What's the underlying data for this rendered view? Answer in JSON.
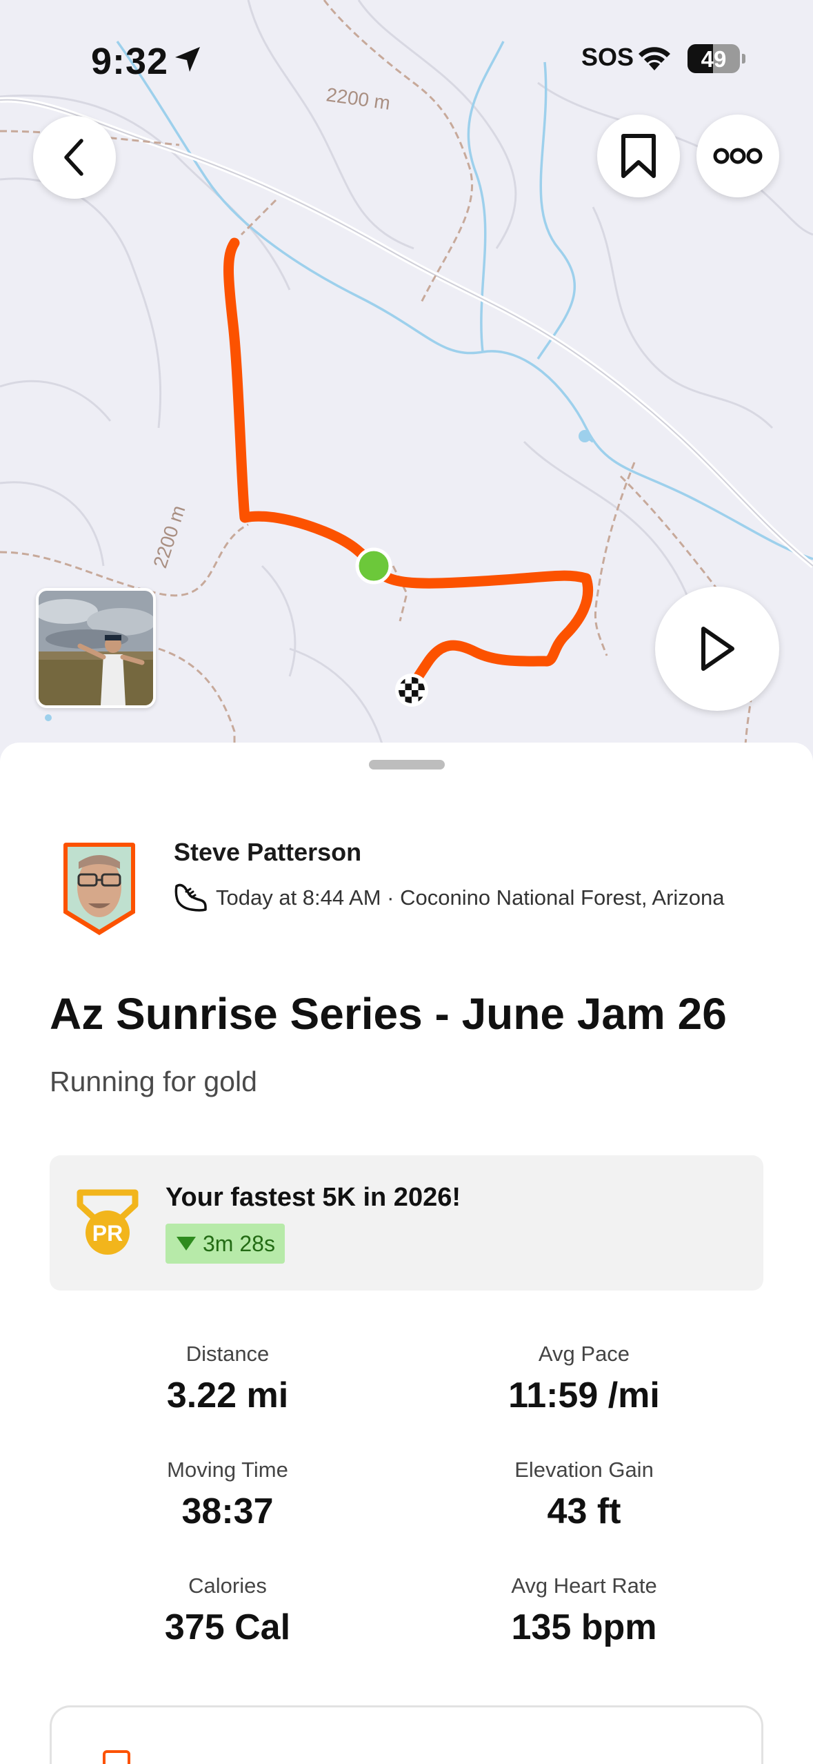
{
  "status_bar": {
    "time": "9:32",
    "sos": "SOS",
    "battery": "49",
    "battery_level": 0.49
  },
  "map": {
    "contour_labels": [
      "2200 m",
      "2200 m"
    ]
  },
  "activity": {
    "athlete_name": "Steve Patterson",
    "meta": "Today at 8:44 AM · Coconino National Forest, Arizona",
    "title": "Az Sunrise Series - June Jam 26",
    "description": "Running for gold",
    "pr": {
      "text": "Your fastest 5K in 2026!",
      "badge_icon_text": "PR",
      "delta": "3m 28s"
    },
    "stats": [
      {
        "label": "Distance",
        "value": "3.22 mi"
      },
      {
        "label": "Avg Pace",
        "value": "11:59 /mi"
      },
      {
        "label": "Moving Time",
        "value": "38:37"
      },
      {
        "label": "Elevation Gain",
        "value": "43 ft"
      },
      {
        "label": "Calories",
        "value": "375 Cal"
      },
      {
        "label": "Avg Heart Rate",
        "value": "135 bpm"
      }
    ]
  },
  "colors": {
    "route": "#fc5200",
    "start_marker": "#6cc83a",
    "pr_badge_bg": "#b7eaa9",
    "pr_medal": "#f2b51c"
  },
  "icons": [
    "location-arrow-icon",
    "wifi-icon",
    "back-chevron-icon",
    "bookmark-icon",
    "more-dots-icon",
    "play-icon",
    "shoe-icon",
    "pr-medal-icon",
    "finish-flag-icon"
  ]
}
